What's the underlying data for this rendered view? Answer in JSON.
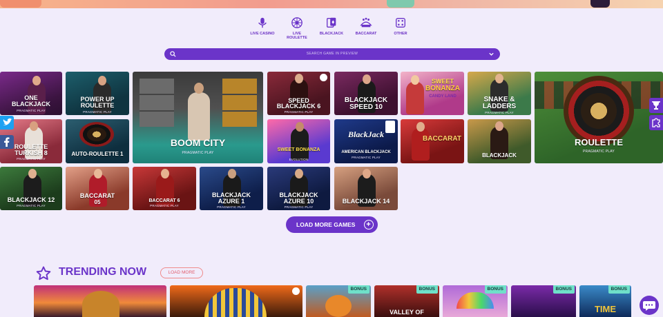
{
  "nav": [
    {
      "label": "LIVE CASINO",
      "icon": "microphone-icon"
    },
    {
      "label": "LIVE",
      "label2": "ROULETTE",
      "icon": "roulette-wheel-icon"
    },
    {
      "label": "BLACKJACK",
      "icon": "cards-icon"
    },
    {
      "label": "BACCARAT",
      "icon": "table-icon"
    },
    {
      "label": "OTHER",
      "icon": "dice-icon"
    }
  ],
  "search": {
    "placeholder": "SEARCH GAME IN PREVIEW"
  },
  "games": [
    {
      "title": "ONE BLACKJACK",
      "line1": "ONE",
      "line2": "BLACKJACK",
      "provider": "PRAGMATIC PLAY"
    },
    {
      "title": "POWER UP ROULETTE",
      "line1": "POWER UP",
      "line2": "ROULETTE",
      "provider": "PRAGMATIC PLAY"
    },
    {
      "title": "BOOM CITY",
      "line1": "BOOM CITY",
      "provider": "PRAGMATIC PLAY"
    },
    {
      "title": "SPEED BLACKJACK 6",
      "line1": "SPEED",
      "line2": "BLACKJACK 6",
      "provider": "PRAGMATIC PLAY"
    },
    {
      "title": "BLACKJACK SPEED 10",
      "line1": "BLACKJACK",
      "line2": "SPEED 10",
      "provider": ""
    },
    {
      "title": "SWEET BONANZA CANDYLAND",
      "line1": "SWEET",
      "line2": "BONANZA",
      "line3": "CANDY LAND",
      "provider": ""
    },
    {
      "title": "SNAKE & LADDERS",
      "line1": "SNAKE &",
      "line2": "LADDERS",
      "provider": "PRAGMATIC PLAY"
    },
    {
      "title": "ROULETTE",
      "line1": "ROULETTE",
      "provider": "PRAGMATIC PLAY"
    },
    {
      "title": "ROULETTE TURKISH 8",
      "line1": "ROULETTE",
      "line2": "TURKISH 8",
      "provider": "PRAGMATIC PLAY"
    },
    {
      "title": "AUTO-ROULETTE 1",
      "line1": "AUTO-ROULETTE 1",
      "provider": ""
    },
    {
      "title": "SWEET BONANZA",
      "line1": "SWEET BONANZA",
      "provider": "EVOLUTION"
    },
    {
      "title": "AMERICAN BLACKJACK",
      "line1": "BlackJack",
      "line2": "AMERICAN BLACKJACK",
      "provider": "PRAGMATIC PLAY"
    },
    {
      "title": "BACCARAT",
      "line1": "BACCARAT",
      "provider": ""
    },
    {
      "title": "BLACKJACK",
      "line1": "BLACKJACK",
      "provider": ""
    },
    {
      "title": "BLACKJACK 12",
      "line1": "BLACKJACK 12",
      "provider": "PRAGMATIC PLAY"
    },
    {
      "title": "BACCARAT 05",
      "line1": "BACCARAT",
      "line2": "05",
      "provider": ""
    },
    {
      "title": "BACCARAT 6",
      "line1": "BACCARAT 6",
      "provider": "PRAGMATIC PLAY"
    },
    {
      "title": "BLACKJACK AZURE 1",
      "line1": "BLACKJACK",
      "line2": "AZURE 1",
      "provider": "PRAGMATIC PLAY"
    },
    {
      "title": "BLACKJACK AZURE 10",
      "line1": "BLACKJACK",
      "line2": "AZURE 10",
      "provider": "PRAGMATIC PLAY"
    },
    {
      "title": "BLACKJACK 14",
      "line1": "BLACKJACK 14",
      "provider": ""
    }
  ],
  "load_more": {
    "label": "LOAD MORE GAMES"
  },
  "trending": {
    "title": "TRENDING NOW",
    "button": "LOAD MORE",
    "badge": "BONUS",
    "tiles": [
      {
        "name": "lion",
        "text": ""
      },
      {
        "name": "pharaoh",
        "text": ""
      },
      {
        "name": "fire-tiger",
        "text": ""
      },
      {
        "name": "valley-of",
        "text": "VALLEY OF"
      },
      {
        "name": "rainbow",
        "text": ""
      },
      {
        "name": "queen",
        "text": ""
      },
      {
        "name": "time",
        "text": "TIME"
      }
    ]
  },
  "colors": {
    "accent": "#6b34c9",
    "background": "#f1ecfb",
    "badge": "#6fe0c9"
  }
}
